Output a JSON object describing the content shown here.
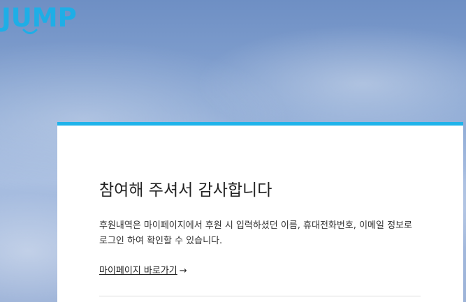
{
  "brand": {
    "logo_text": "JUMP",
    "accent_color": "#1fb3ea"
  },
  "card": {
    "title": "참여해 주셔서 감사합니다",
    "description": "후원내역은 마이페이지에서 후원 시 입력하셨던 이름, 휴대전화번호, 이메일 정보로 로그인 하여 확인할 수 있습니다.",
    "mypage_link_label": "마이페이지 바로가기",
    "mypage_link_icon": "arrow-right-icon",
    "arrow_glyph": "→"
  }
}
